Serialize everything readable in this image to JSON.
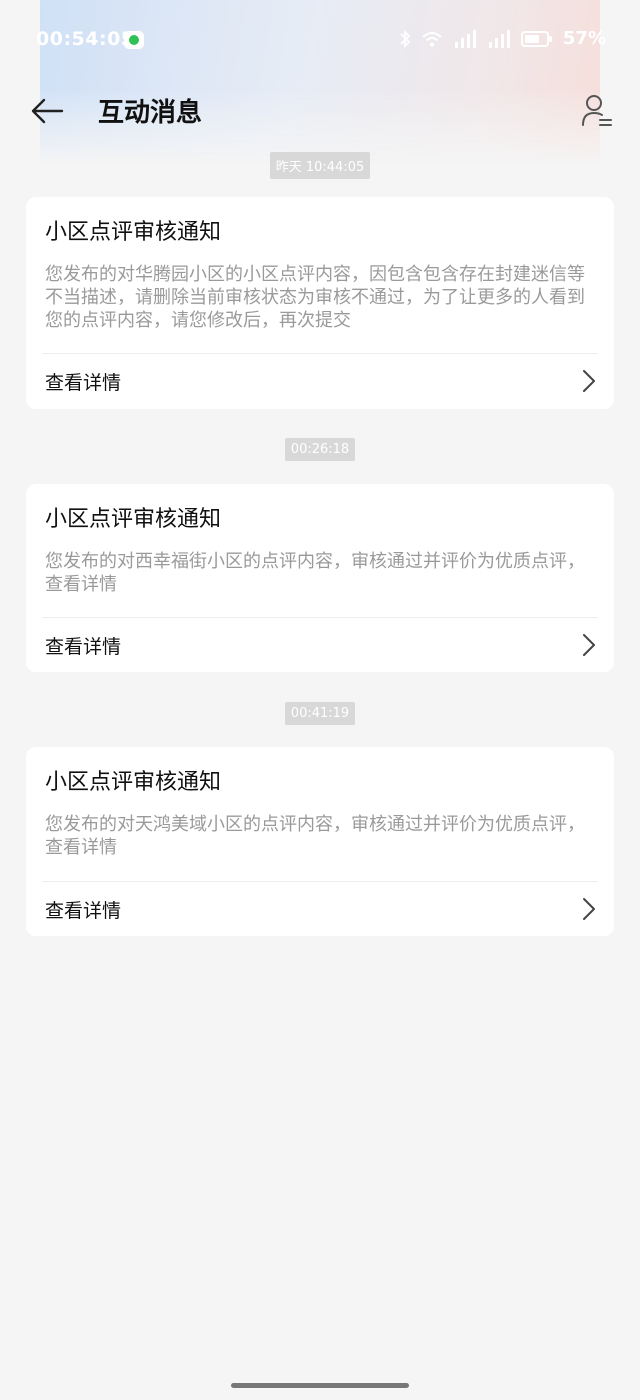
{
  "status_bar": {
    "time": "00:54:05",
    "battery": "57%",
    "icons": [
      "wechat-app-icon",
      "bluetooth-icon",
      "wifi-icon",
      "signal-icon",
      "signal-icon",
      "battery-icon"
    ]
  },
  "header": {
    "title": "互动消息",
    "back_icon": "arrow-left-icon",
    "user_icon": "user-settings-icon"
  },
  "messages": [
    {
      "timestamp": "昨天 10:44:05",
      "title": "小区点评审核通知",
      "body": "您发布的对华腾园小区的小区点评内容，因包含包含存在封建迷信等不当描述，请删除当前审核状态为审核不通过，为了让更多的人看到您的点评内容，请您修改后，再次提交",
      "action": "查看详情"
    },
    {
      "timestamp": "00:26:18",
      "title": "小区点评审核通知",
      "body": "您发布的对西幸福街小区的点评内容，审核通过并评价为优质点评，查看详情",
      "action": "查看详情"
    },
    {
      "timestamp": "00:41:19",
      "title": "小区点评审核通知",
      "body": "您发布的对天鸿美域小区的点评内容，审核通过并评价为优质点评，查看详情",
      "action": "查看详情"
    }
  ],
  "colors": {
    "background": "#f5f5f5",
    "card": "#ffffff",
    "title_text": "#111111",
    "body_text": "#9a9a9a",
    "timestamp_bg": "#d8d8d8"
  }
}
